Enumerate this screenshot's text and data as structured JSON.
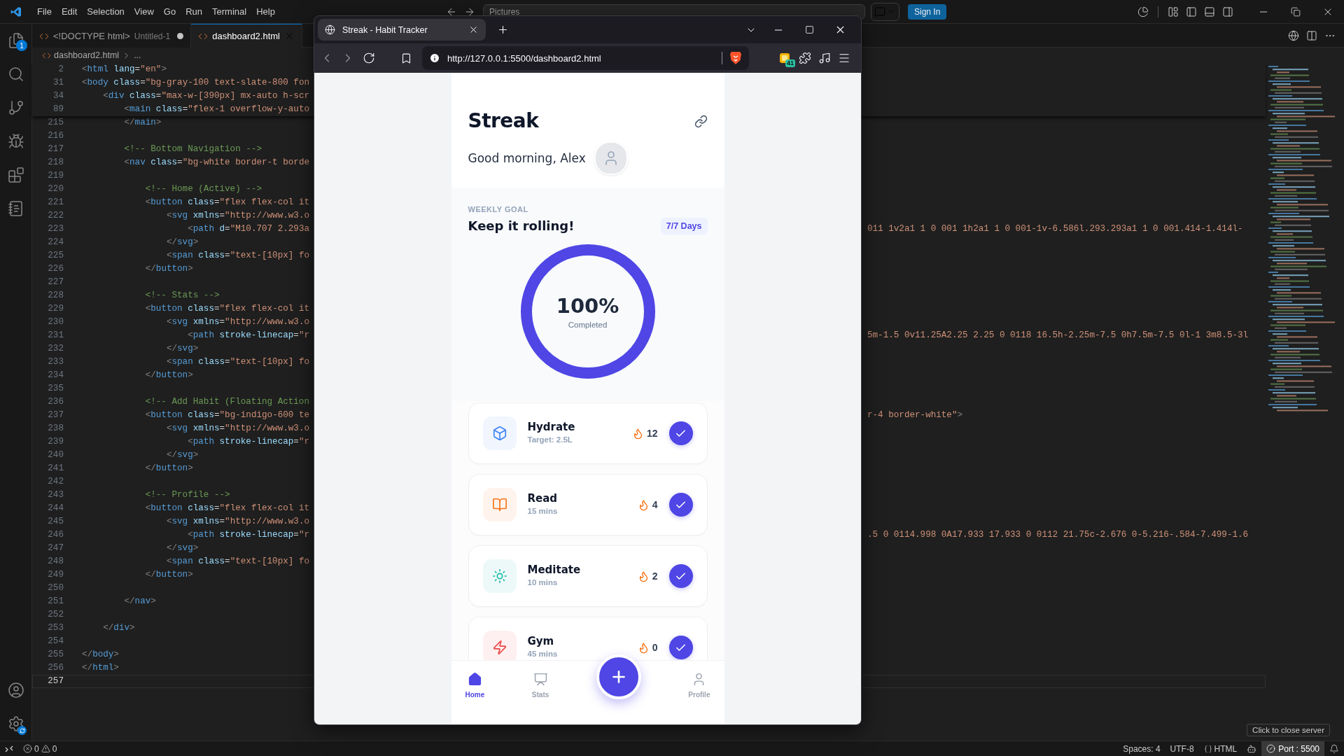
{
  "vscode": {
    "menu": [
      "File",
      "Edit",
      "Selection",
      "View",
      "Go",
      "Run",
      "Terminal",
      "Help"
    ],
    "command_center": "Pictures",
    "sign_in": "Sign In",
    "explorer_badge": "1",
    "tabs": [
      {
        "label": "<!DOCTYPE html>",
        "description": "Untitled-1",
        "modified": true,
        "selected": false
      },
      {
        "label": "dashboard2.html",
        "modified": false,
        "selected": true
      }
    ],
    "breadcrumb": [
      "dashboard2.html",
      "..."
    ],
    "sticky_lines": [
      {
        "num": "2",
        "code": "<html lang=\"en\">"
      },
      {
        "num": "31",
        "code": "<body class=\"bg-gray-100 text-slate-800 fon"
      },
      {
        "num": "34",
        "code": "    <div class=\"max-w-[390px] mx-auto h-scr"
      },
      {
        "num": "89",
        "code": "        <main class=\"flex-1 overflow-y-auto"
      }
    ],
    "lines": [
      {
        "num": "215",
        "code": "        </main>",
        "current": false
      },
      {
        "num": "216",
        "current": false
      },
      {
        "num": "217",
        "code": "        <!-- Bottom Navigation -->",
        "current": false
      },
      {
        "num": "218",
        "code": "        <nav class=\"bg-white border-t borde",
        "current": false
      },
      {
        "num": "219",
        "current": false
      },
      {
        "num": "220",
        "code": "            <!-- Home (Active) -->",
        "current": false
      },
      {
        "num": "221",
        "code": "            <button class=\"flex flex-col it",
        "current": false
      },
      {
        "num": "222",
        "code": "                <svg xmlns=\"http://www.w3.o",
        "current": false
      },
      {
        "num": "223",
        "code": "                    <path d=\"M10.707 2.293a",
        "tail": "011 1v2a1 1 0 001 1h2a1 1 0 001-1v-6.586l.293.293a1 1 0 001.414-1.414l-",
        "current": false
      },
      {
        "num": "224",
        "code": "                </svg>",
        "current": false
      },
      {
        "num": "225",
        "code": "                <span class=\"text-[10px] fo",
        "current": false
      },
      {
        "num": "226",
        "code": "            </button>",
        "current": false
      },
      {
        "num": "227",
        "current": false
      },
      {
        "num": "228",
        "code": "            <!-- Stats -->",
        "current": false
      },
      {
        "num": "229",
        "code": "            <button class=\"flex flex-col it",
        "current": false
      },
      {
        "num": "230",
        "code": "                <svg xmlns=\"http://www.w3.o",
        "current": false
      },
      {
        "num": "231",
        "code": "                    <path stroke-linecap=\"r",
        "tail": "5m-1.5 0v11.25A2.25 2.25 0 0118 16.5h-2.25m-7.5 0h7.5m-7.5 0l-1 3m8.5-3l",
        "current": false
      },
      {
        "num": "232",
        "code": "                </svg>",
        "current": false
      },
      {
        "num": "233",
        "code": "                <span class=\"text-[10px] fo",
        "current": false
      },
      {
        "num": "234",
        "code": "            </button>",
        "current": false
      },
      {
        "num": "235",
        "current": false
      },
      {
        "num": "236",
        "code": "            <!-- Add Habit (Floating Action",
        "current": false
      },
      {
        "num": "237",
        "code": "            <button class=\"bg-indigo-600 te",
        "tail": "r-4 border-white\">",
        "current": false
      },
      {
        "num": "238",
        "code": "                <svg xmlns=\"http://www.w3.o",
        "current": false
      },
      {
        "num": "239",
        "code": "                    <path stroke-linecap=\"r",
        "current": false
      },
      {
        "num": "240",
        "code": "                </svg>",
        "current": false
      },
      {
        "num": "241",
        "code": "            </button>",
        "current": false
      },
      {
        "num": "242",
        "current": false
      },
      {
        "num": "243",
        "code": "            <!-- Profile -->",
        "current": false
      },
      {
        "num": "244",
        "code": "            <button class=\"flex flex-col it",
        "current": false
      },
      {
        "num": "245",
        "code": "                <svg xmlns=\"http://www.w3.o",
        "current": false
      },
      {
        "num": "246",
        "code": "                    <path stroke-linecap=\"r",
        "tail": ".5 0 0114.998 0A17.933 17.933 0 0112 21.75c-2.676 0-5.216-.584-7.499-1.6",
        "current": false
      },
      {
        "num": "247",
        "code": "                </svg>",
        "current": false
      },
      {
        "num": "248",
        "code": "                <span class=\"text-[10px] fo",
        "current": false
      },
      {
        "num": "249",
        "code": "            </button>",
        "current": false
      },
      {
        "num": "250",
        "current": false
      },
      {
        "num": "251",
        "code": "        </nav>",
        "current": false
      },
      {
        "num": "252",
        "current": false
      },
      {
        "num": "253",
        "code": "    </div>",
        "current": false
      },
      {
        "num": "254",
        "current": false
      },
      {
        "num": "255",
        "code": "</body>",
        "current": false
      },
      {
        "num": "256",
        "code": "</html>",
        "current": false
      },
      {
        "num": "257",
        "current": true
      }
    ]
  },
  "status_bar": {
    "errors": "0",
    "warnings": "0",
    "spaces": "Spaces: 4",
    "encoding": "UTF-8",
    "language": "HTML",
    "port": "Port : 5500",
    "tooltip": "Click to close server"
  },
  "browser": {
    "tab_title": "Streak - Habit Tracker",
    "url": "http://127.0.0.1:5500/dashboard2.html",
    "extension_badge": "41"
  },
  "app": {
    "title": "Streak",
    "greeting": "Good morning, Alex",
    "goal": {
      "label": "WEEKLY GOAL",
      "heading": "Keep it rolling!",
      "badge": "7/7 Days",
      "level": 1,
      "percent": "100%",
      "caption": "Completed"
    },
    "habits": [
      {
        "name": "Hydrate",
        "detail": "Target: 2.5L",
        "streak": "12",
        "done": true,
        "kind": "cube",
        "color": "#3b82f6"
      },
      {
        "name": "Read",
        "detail": "15 mins",
        "streak": "4",
        "done": true,
        "kind": "book",
        "color": "#f97316"
      },
      {
        "name": "Meditate",
        "detail": "10 mins",
        "streak": "2",
        "done": true,
        "kind": "sun",
        "color": "#14b8a6"
      },
      {
        "name": "Gym",
        "detail": "45 mins",
        "streak": "0",
        "done": true,
        "kind": "bolt",
        "color": "#ef4444"
      }
    ],
    "nav": [
      {
        "label": "Home",
        "kind": "home",
        "selected": true
      },
      {
        "label": "Stats",
        "kind": "stats",
        "selected": false
      },
      {
        "kind": "add",
        "selected": false
      },
      {
        "label": "Profile",
        "kind": "profile",
        "selected": false
      }
    ]
  }
}
